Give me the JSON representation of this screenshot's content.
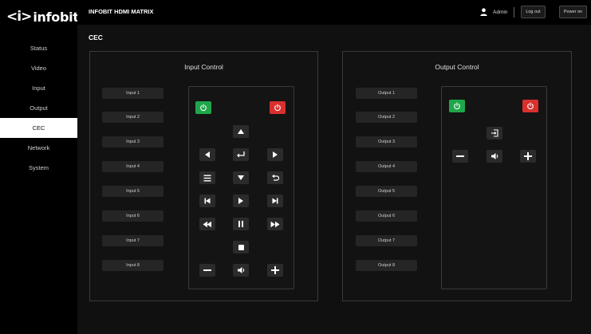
{
  "logo": {
    "mark": "<i>",
    "text": "infobit"
  },
  "app_title": "INFOBIT HDMI MATRIX",
  "user": {
    "name": "Admin"
  },
  "header_buttons": {
    "logout": "Log out",
    "power_on": "Power on"
  },
  "nav": [
    "Status",
    "Video",
    "Input",
    "Output",
    "CEC",
    "Network",
    "System"
  ],
  "nav_active": "CEC",
  "page_title": "CEC",
  "input_control": {
    "title": "Input Control",
    "ports": [
      "Input 1",
      "Input 2",
      "Input 3",
      "Input 4",
      "Input 5",
      "Input 6",
      "Input 7",
      "Input 8"
    ]
  },
  "output_control": {
    "title": "Output Control",
    "ports": [
      "Output 1",
      "Output 2",
      "Output 3",
      "Output 4",
      "Output 5",
      "Output 6",
      "Output 7",
      "Output 8"
    ]
  },
  "colors": {
    "power_on": "#1fa64a",
    "power_off": "#d9302e",
    "nav_active_bg": "#ffffff"
  }
}
